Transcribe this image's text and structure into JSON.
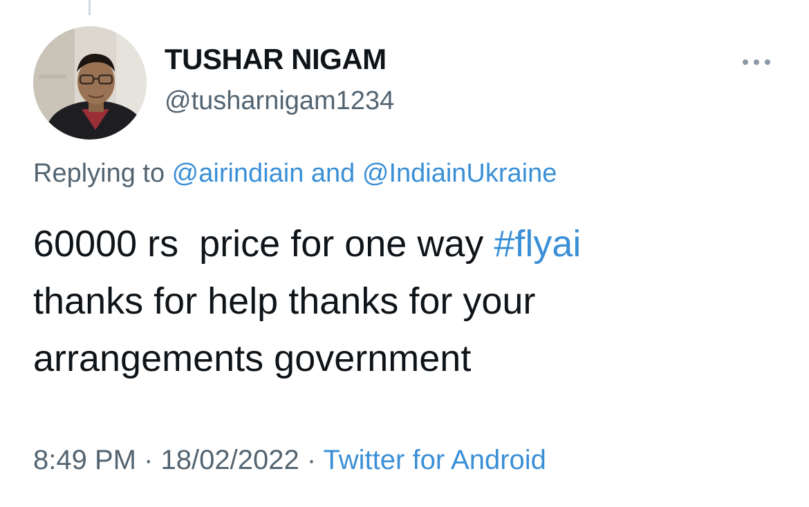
{
  "author": {
    "display_name": "TUSHAR NIGAM",
    "handle": "@tusharnigam1234"
  },
  "more_icon": "ellipsis-horizontal",
  "reply_context": {
    "prefix": "Replying to ",
    "mention_1": "@airindiain",
    "separator": " and ",
    "mention_2": "@IndiainUkraine"
  },
  "tweet": {
    "line_1_text": "60000 rs  price for one way ",
    "line_1_hashtag": "#flyai",
    "line_2": "thanks for help thanks for your",
    "line_3": "arrangements government"
  },
  "meta": {
    "time": "8:49 PM",
    "dot": " · ",
    "date": "18/02/2022",
    "source": "Twitter for Android"
  },
  "colors": {
    "link": "#3a8fd6",
    "secondary_text": "#536471",
    "primary_text": "#0f1419"
  }
}
